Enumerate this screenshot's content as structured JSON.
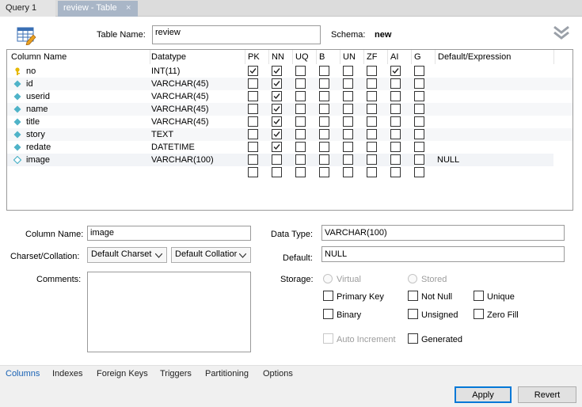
{
  "tabs": [
    {
      "label": "Query 1",
      "active": false
    },
    {
      "label": "review - Table",
      "active": true,
      "close": "×"
    }
  ],
  "header": {
    "table_name_label": "Table Name:",
    "table_name_value": "review",
    "schema_label": "Schema:",
    "schema_value": "new"
  },
  "grid": {
    "columns": [
      "Column Name",
      "Datatype",
      "PK",
      "NN",
      "UQ",
      "B",
      "UN",
      "ZF",
      "AI",
      "G",
      "Default/Expression"
    ],
    "rows": [
      {
        "name": "no",
        "type": "INT(11)",
        "icon": "key-icon",
        "flags": [
          1,
          1,
          0,
          0,
          0,
          0,
          1,
          0
        ],
        "default": ""
      },
      {
        "name": "id",
        "type": "VARCHAR(45)",
        "icon": "column-diamond-icon",
        "flags": [
          0,
          1,
          0,
          0,
          0,
          0,
          0,
          0
        ],
        "default": ""
      },
      {
        "name": "userid",
        "type": "VARCHAR(45)",
        "icon": "column-diamond-icon",
        "flags": [
          0,
          1,
          0,
          0,
          0,
          0,
          0,
          0
        ],
        "default": ""
      },
      {
        "name": "name",
        "type": "VARCHAR(45)",
        "icon": "column-diamond-icon",
        "flags": [
          0,
          1,
          0,
          0,
          0,
          0,
          0,
          0
        ],
        "default": ""
      },
      {
        "name": "title",
        "type": "VARCHAR(45)",
        "icon": "column-diamond-icon",
        "flags": [
          0,
          1,
          0,
          0,
          0,
          0,
          0,
          0
        ],
        "default": ""
      },
      {
        "name": "story",
        "type": "TEXT",
        "icon": "column-diamond-icon",
        "flags": [
          0,
          1,
          0,
          0,
          0,
          0,
          0,
          0
        ],
        "default": ""
      },
      {
        "name": "redate",
        "type": "DATETIME",
        "icon": "column-diamond-icon",
        "flags": [
          0,
          1,
          0,
          0,
          0,
          0,
          0,
          0
        ],
        "default": ""
      },
      {
        "name": "image",
        "type": "VARCHAR(100)",
        "icon": "column-diamond-outline-icon",
        "flags": [
          0,
          0,
          0,
          0,
          0,
          0,
          0,
          0
        ],
        "default": "NULL"
      },
      {
        "name": "",
        "type": "",
        "icon": "",
        "flags": [
          0,
          0,
          0,
          0,
          0,
          0,
          0,
          0
        ],
        "default": ""
      }
    ]
  },
  "details": {
    "column_name_label": "Column Name:",
    "column_name_value": "image",
    "charset_label": "Charset/Collation:",
    "charset_value": "Default Charset",
    "collation_value": "Default Collatior",
    "comments_label": "Comments:",
    "comments_value": "",
    "data_type_label": "Data Type:",
    "data_type_value": "VARCHAR(100)",
    "default_label": "Default:",
    "default_value": "NULL",
    "storage_label": "Storage:",
    "virtual_label": "Virtual",
    "stored_label": "Stored",
    "primary_key_label": "Primary Key",
    "not_null_label": "Not Null",
    "unique_label": "Unique",
    "binary_label": "Binary",
    "unsigned_label": "Unsigned",
    "zero_fill_label": "Zero Fill",
    "auto_increment_label": "Auto Increment",
    "generated_label": "Generated"
  },
  "bottom_tabs": [
    "Columns",
    "Indexes",
    "Foreign Keys",
    "Triggers",
    "Partitioning",
    "Options"
  ],
  "buttons": {
    "apply": "Apply",
    "revert": "Revert"
  },
  "colors": {
    "accent": "#0078d7",
    "active_tab": "#a9b6c7",
    "column_icon": "#4fb3c8",
    "key_icon": "#e6b800"
  }
}
